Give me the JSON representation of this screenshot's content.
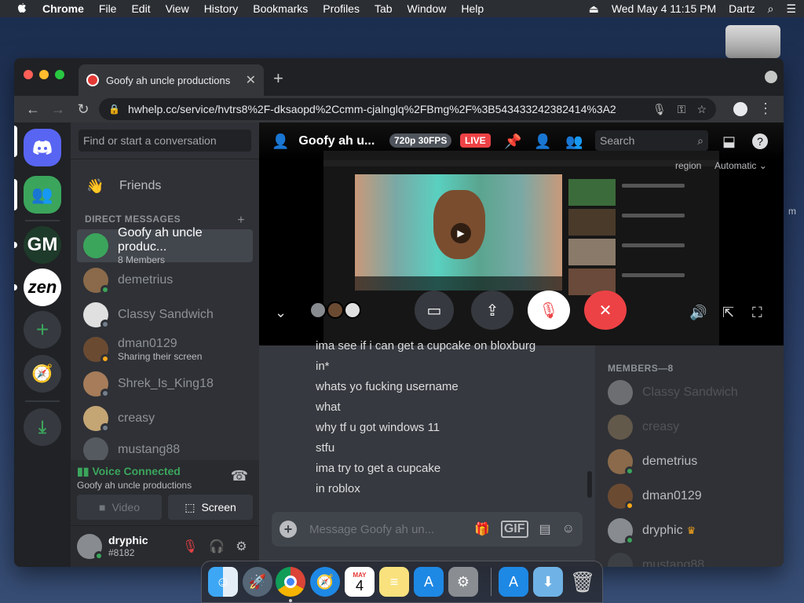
{
  "menubar": {
    "app": "Chrome",
    "items": [
      "File",
      "Edit",
      "View",
      "History",
      "Bookmarks",
      "Profiles",
      "Tab",
      "Window",
      "Help"
    ],
    "clock": "Wed May 4  11:15 PM",
    "user": "Dartz"
  },
  "browser": {
    "tab_title": "Goofy ah uncle productions",
    "url": "hwhelp.cc/service/hvtrs8%2F-dksaopd%2Ccmm-cjalnglq%2FBmg%2F%3B543433242382414%3A2"
  },
  "sidebar": {
    "search_placeholder": "Find or start a conversation",
    "friends_label": "Friends",
    "dm_header": "DIRECT MESSAGES",
    "dms": [
      {
        "name": "Goofy ah uncle produc...",
        "sub": "8 Members",
        "active": true,
        "status": "",
        "color": "#3ba55c"
      },
      {
        "name": "demetrius",
        "sub": "",
        "active": false,
        "status": "online",
        "color": "#8a6a4a"
      },
      {
        "name": "Classy Sandwich",
        "sub": "",
        "active": false,
        "status": "offline",
        "color": "#e0e0e0"
      },
      {
        "name": "dman0129",
        "sub": "Sharing their screen",
        "active": false,
        "status": "idle",
        "color": "#6b4a32"
      },
      {
        "name": "Shrek_Is_King18",
        "sub": "",
        "active": false,
        "status": "offline",
        "color": "#a67c5a"
      },
      {
        "name": "creasy",
        "sub": "",
        "active": false,
        "status": "offline",
        "color": "#c4a574"
      },
      {
        "name": "mustang88",
        "sub": "",
        "active": false,
        "status": "",
        "color": "#555a60"
      }
    ]
  },
  "voice": {
    "status": "Voice Connected",
    "channel": "Goofy ah uncle productions",
    "video_label": "Video",
    "screen_label": "Screen"
  },
  "user_panel": {
    "username": "dryphic",
    "tag": "#8182"
  },
  "stream": {
    "title": "Goofy ah u...",
    "quality": "720p 30FPS",
    "live": "LIVE",
    "search_placeholder": "Search",
    "region": "region",
    "region_value": "Automatic"
  },
  "chat": {
    "messages": [
      "ima see if i can get a cupcake on bloxburg",
      "in*",
      "whats yo fucking username",
      "what",
      "why tf u got windows 11",
      "stfu",
      "ima try to get a cupcake",
      "in roblox"
    ],
    "composer_placeholder": "Message Goofy ah un...",
    "gif_label": "GIF"
  },
  "members": {
    "header": "MEMBERS—8",
    "list": [
      {
        "name": "Classy Sandwich",
        "offline": true,
        "status": "",
        "crown": false,
        "color": "#e0e0e0"
      },
      {
        "name": "creasy",
        "offline": true,
        "status": "",
        "crown": false,
        "color": "#c4a574"
      },
      {
        "name": "demetrius",
        "offline": false,
        "status": "online",
        "crown": false,
        "color": "#8a6a4a"
      },
      {
        "name": "dman0129",
        "offline": false,
        "status": "idle",
        "crown": false,
        "color": "#6b4a32"
      },
      {
        "name": "dryphic",
        "offline": false,
        "status": "online",
        "crown": true,
        "color": "#888c91"
      },
      {
        "name": "mustang88",
        "offline": true,
        "status": "",
        "crown": false,
        "color": "#555a60"
      }
    ]
  },
  "guilds": {
    "gm_label": "GM",
    "zen_label": "zen"
  },
  "dock": {
    "calendar_month": "MAY",
    "calendar_day": "4"
  },
  "colors": {
    "blurple": "#5865f2",
    "green": "#3ba55c",
    "red": "#ed4245",
    "idle": "#faa81a"
  }
}
